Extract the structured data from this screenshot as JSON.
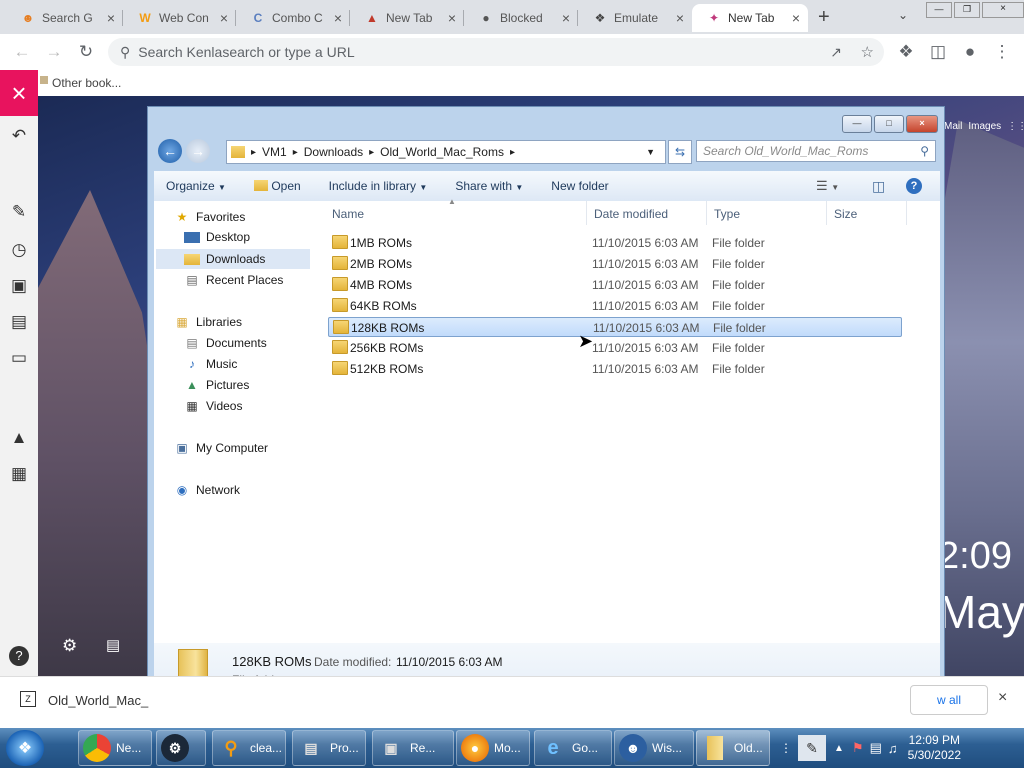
{
  "browser": {
    "tabs": [
      {
        "title": "Search G",
        "icon": "person-icon",
        "color": "#e67e22"
      },
      {
        "title": "Web Con",
        "icon": "w-logo-icon",
        "color": "#f39c12"
      },
      {
        "title": "Combo C",
        "icon": "c-logo-icon",
        "color": "#5b7fbf"
      },
      {
        "title": "New Tab",
        "icon": "rainbow-icon",
        "color": "#c0392b"
      },
      {
        "title": "Blocked",
        "icon": "globe-icon",
        "color": "#555555"
      },
      {
        "title": "Emulate",
        "icon": "puzzle-icon",
        "color": "#444444"
      },
      {
        "title": "New Tab",
        "icon": "ribbon-icon",
        "color": "#c0397b"
      }
    ],
    "omnibox_placeholder": "Search Kenlasearch or type a URL",
    "bookmarks_label": "Other book..."
  },
  "desktop": {
    "clock": "2:09",
    "date": "May",
    "links": [
      "Mail",
      "Images"
    ]
  },
  "explorer": {
    "path": [
      "VM1",
      "Downloads",
      "Old_World_Mac_Roms"
    ],
    "search_placeholder": "Search Old_World_Mac_Roms",
    "commands": [
      "Organize",
      "Open",
      "Include in library",
      "Share with",
      "New folder"
    ],
    "nav": {
      "favorites_label": "Favorites",
      "favorites": [
        "Desktop",
        "Downloads",
        "Recent Places"
      ],
      "libraries_label": "Libraries",
      "libraries": [
        "Documents",
        "Music",
        "Pictures",
        "Videos"
      ],
      "computer_label": "My Computer",
      "network_label": "Network"
    },
    "columns": {
      "name": "Name",
      "date": "Date modified",
      "type": "Type",
      "size": "Size"
    },
    "files": [
      {
        "name": "1MB ROMs",
        "date": "11/10/2015 6:03 AM",
        "type": "File folder"
      },
      {
        "name": "2MB ROMs",
        "date": "11/10/2015 6:03 AM",
        "type": "File folder"
      },
      {
        "name": "4MB ROMs",
        "date": "11/10/2015 6:03 AM",
        "type": "File folder"
      },
      {
        "name": "64KB ROMs",
        "date": "11/10/2015 6:03 AM",
        "type": "File folder"
      },
      {
        "name": "128KB ROMs",
        "date": "11/10/2015 6:03 AM",
        "type": "File folder"
      },
      {
        "name": "256KB ROMs",
        "date": "11/10/2015 6:03 AM",
        "type": "File folder"
      },
      {
        "name": "512KB ROMs",
        "date": "11/10/2015 6:03 AM",
        "type": "File folder"
      }
    ],
    "selected_index": 4,
    "details": {
      "name": "128KB ROMs",
      "date_label": "Date modified:",
      "date": "11/10/2015 6:03 AM",
      "type": "File folder"
    }
  },
  "pagebar": {
    "download_name": "Old_World_Mac_",
    "show_all": "w all"
  },
  "taskbar": {
    "items": [
      {
        "label": "Ne...",
        "icon": "chrome-icon"
      },
      {
        "label": "",
        "icon": "steam-icon"
      },
      {
        "label": "clea...",
        "icon": "magnifier-icon"
      },
      {
        "label": "Pro...",
        "icon": "program-icon"
      },
      {
        "label": "Re...",
        "icon": "remote-icon"
      },
      {
        "label": "Mo...",
        "icon": "firefox-icon"
      },
      {
        "label": "Go...",
        "icon": "ie-icon"
      },
      {
        "label": "Wis...",
        "icon": "wise-icon"
      },
      {
        "label": "Old...",
        "icon": "folder-icon"
      }
    ],
    "time": "12:09 PM",
    "date": "5/30/2022"
  }
}
